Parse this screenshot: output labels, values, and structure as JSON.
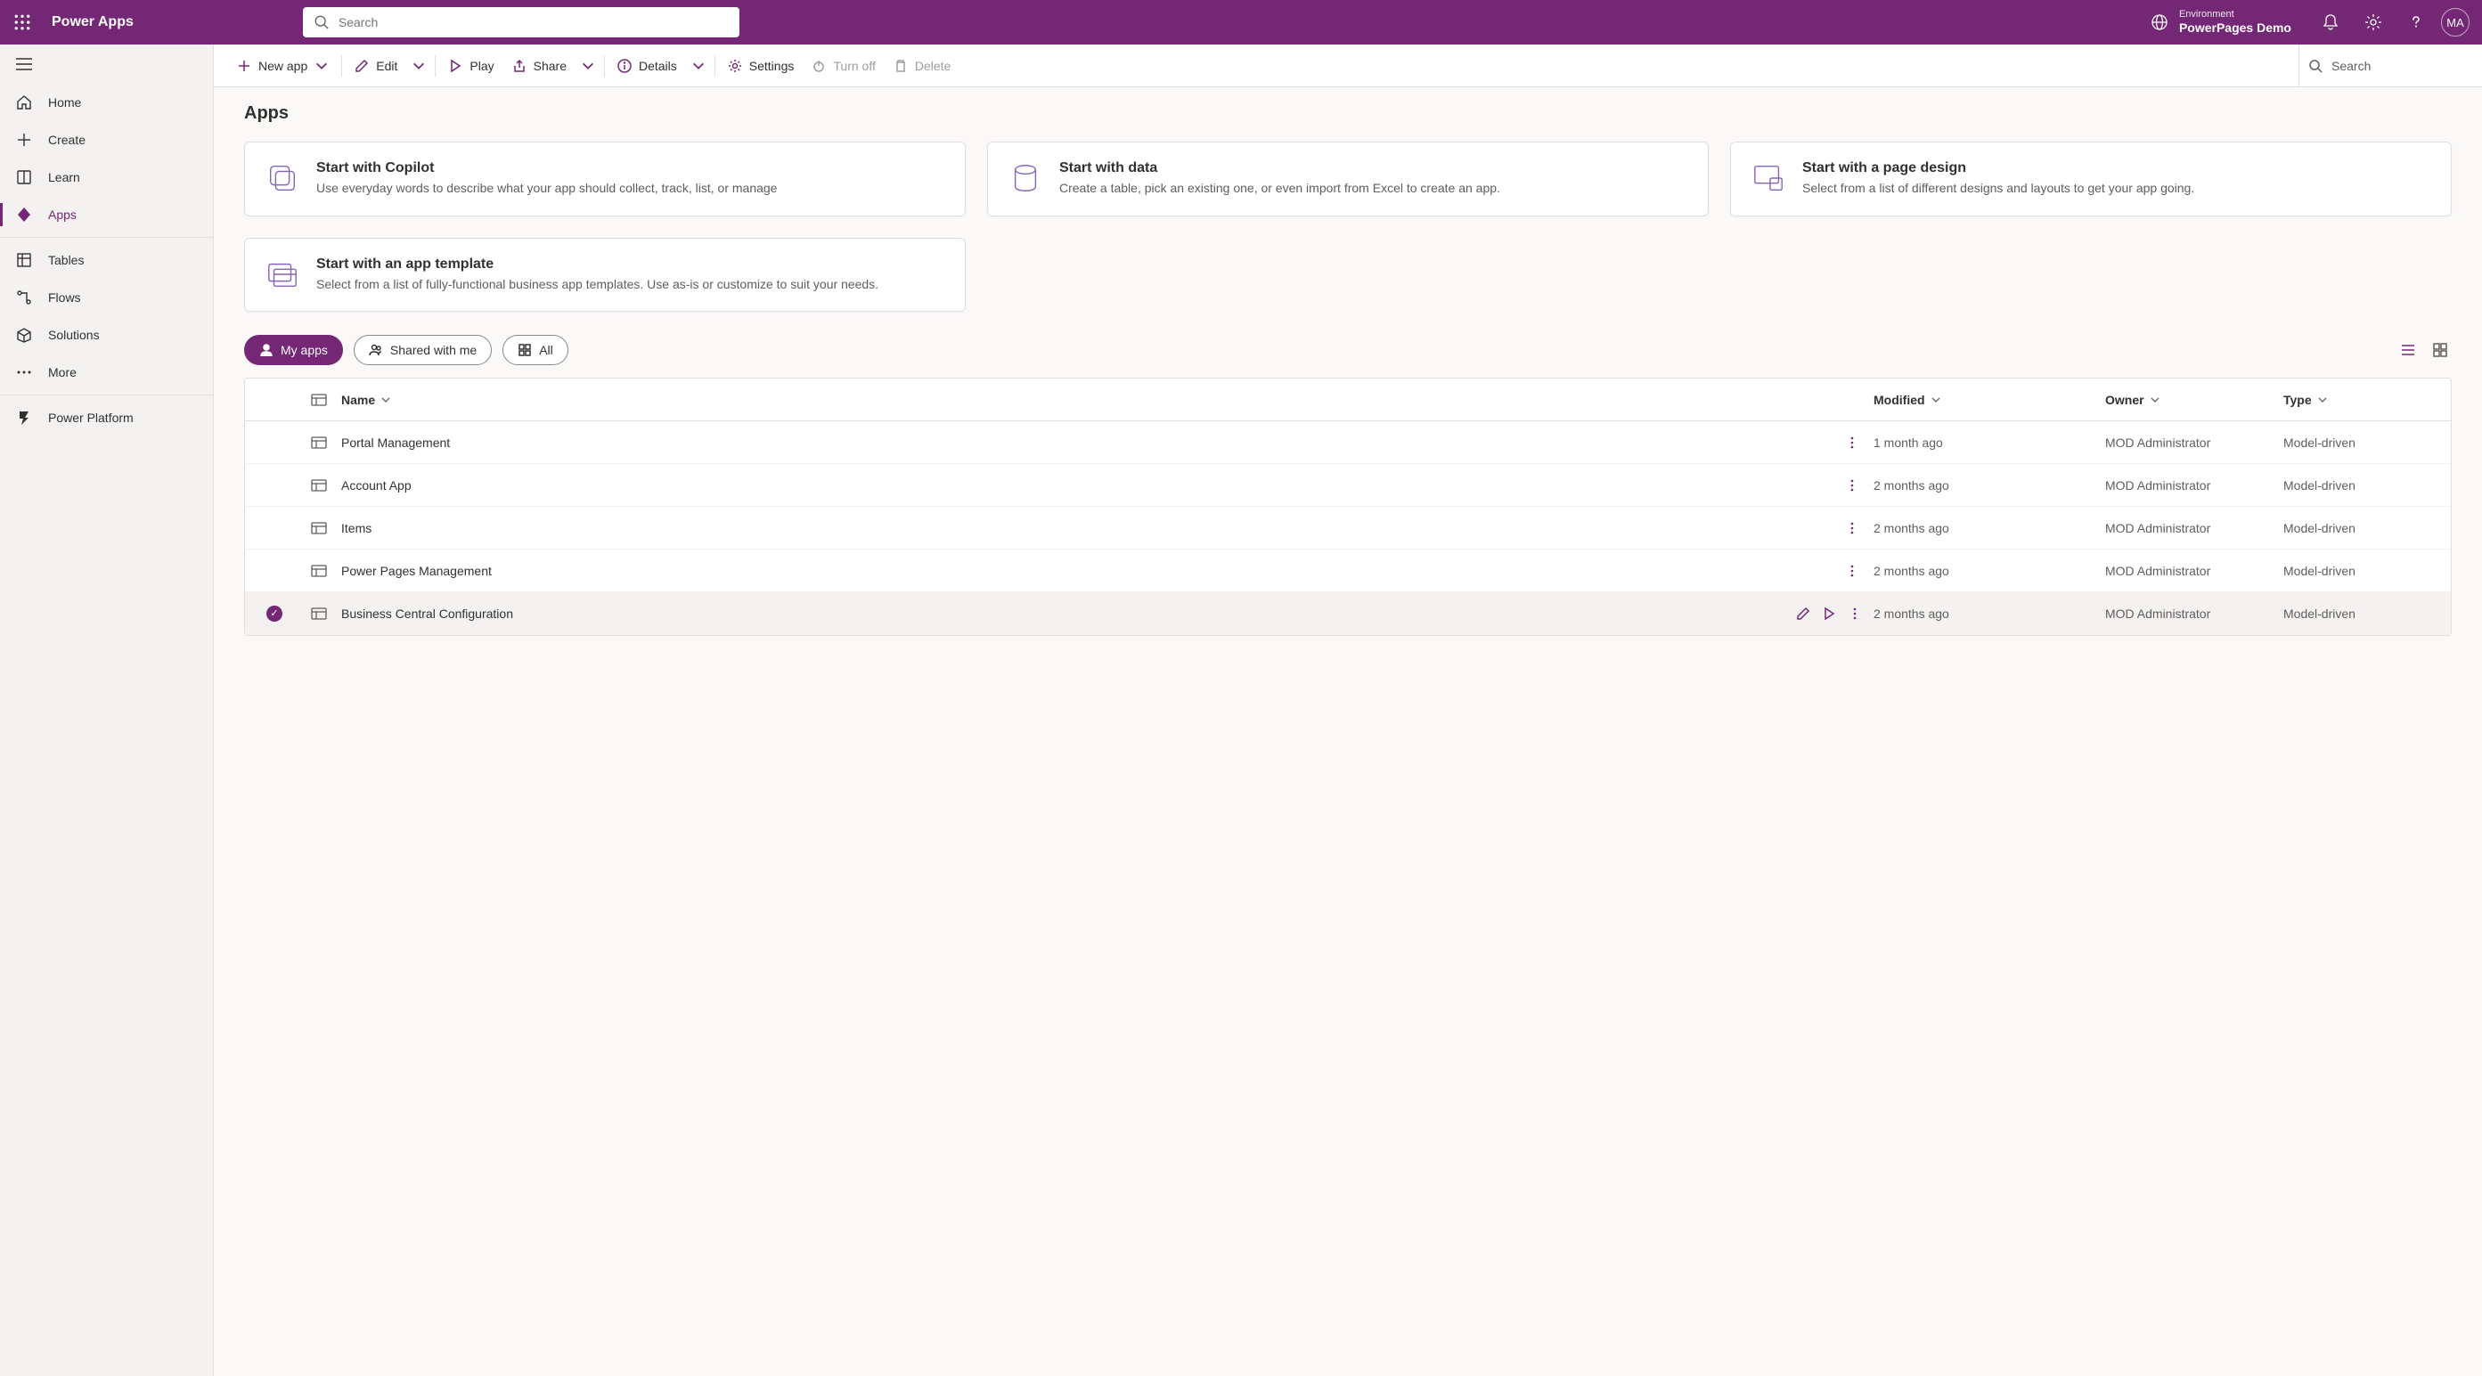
{
  "header": {
    "product": "Power Apps",
    "search_placeholder": "Search",
    "env_label": "Environment",
    "env_name": "PowerPages Demo",
    "avatar": "MA"
  },
  "sidebar": {
    "home": "Home",
    "create": "Create",
    "learn": "Learn",
    "apps": "Apps",
    "tables": "Tables",
    "flows": "Flows",
    "solutions": "Solutions",
    "more": "More",
    "power_platform": "Power Platform"
  },
  "cmdbar": {
    "new_app": "New app",
    "edit": "Edit",
    "play": "Play",
    "share": "Share",
    "details": "Details",
    "settings": "Settings",
    "turn_off": "Turn off",
    "delete": "Delete",
    "search": "Search"
  },
  "page": {
    "title": "Apps"
  },
  "cards": {
    "copilot": {
      "title": "Start with Copilot",
      "desc": "Use everyday words to describe what your app should collect, track, list, or manage"
    },
    "data": {
      "title": "Start with data",
      "desc": "Create a table, pick an existing one, or even import from Excel to create an app."
    },
    "page": {
      "title": "Start with a page design",
      "desc": "Select from a list of different designs and layouts to get your app going."
    },
    "template": {
      "title": "Start with an app template",
      "desc": "Select from a list of fully-functional business app templates. Use as-is or customize to suit your needs."
    }
  },
  "pills": {
    "my_apps": "My apps",
    "shared": "Shared with me",
    "all": "All"
  },
  "table": {
    "columns": {
      "name": "Name",
      "modified": "Modified",
      "owner": "Owner",
      "type": "Type"
    },
    "rows": [
      {
        "name": "Portal Management",
        "modified": "1 month ago",
        "owner": "MOD Administrator",
        "type": "Model-driven",
        "selected": false
      },
      {
        "name": "Account App",
        "modified": "2 months ago",
        "owner": "MOD Administrator",
        "type": "Model-driven",
        "selected": false
      },
      {
        "name": "Items",
        "modified": "2 months ago",
        "owner": "MOD Administrator",
        "type": "Model-driven",
        "selected": false
      },
      {
        "name": "Power Pages Management",
        "modified": "2 months ago",
        "owner": "MOD Administrator",
        "type": "Model-driven",
        "selected": false
      },
      {
        "name": "Business Central Configuration",
        "modified": "2 months ago",
        "owner": "MOD Administrator",
        "type": "Model-driven",
        "selected": true
      }
    ]
  }
}
